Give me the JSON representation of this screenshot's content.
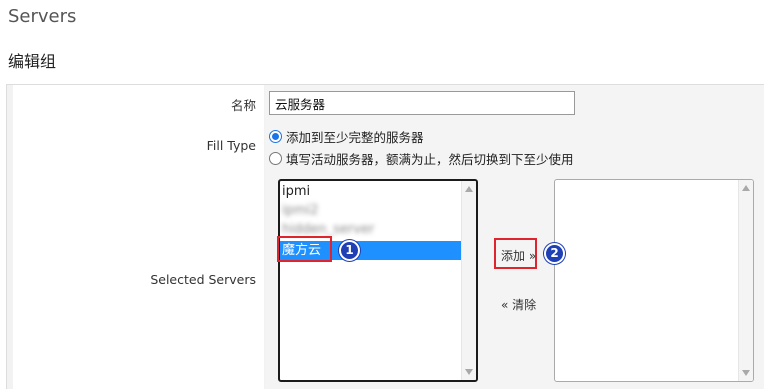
{
  "page": {
    "title": "Servers",
    "section_title": "编辑组"
  },
  "form": {
    "name_label": "名称",
    "name_value": "云服务器",
    "fill_type_label": "Fill Type",
    "fill_type_options": [
      {
        "label": "添加到至少完整的服务器",
        "checked": true
      },
      {
        "label": "填写活动服务器，额满为止，然后切换到下至少使用",
        "checked": false
      }
    ],
    "selected_servers_label": "Selected Servers",
    "available_servers": [
      {
        "label": "ipmi",
        "state": "normal"
      },
      {
        "label": "ipmi2",
        "state": "blurred"
      },
      {
        "label": "hidden_server",
        "state": "blurred"
      },
      {
        "label": "魔方云",
        "state": "selected"
      }
    ],
    "add_button": "添加 »",
    "clear_button": "« 清除"
  },
  "annotations": {
    "step1": "1",
    "step2": "2",
    "highlight_color": "#e0242d",
    "badge_color": "#1f3fb5"
  }
}
